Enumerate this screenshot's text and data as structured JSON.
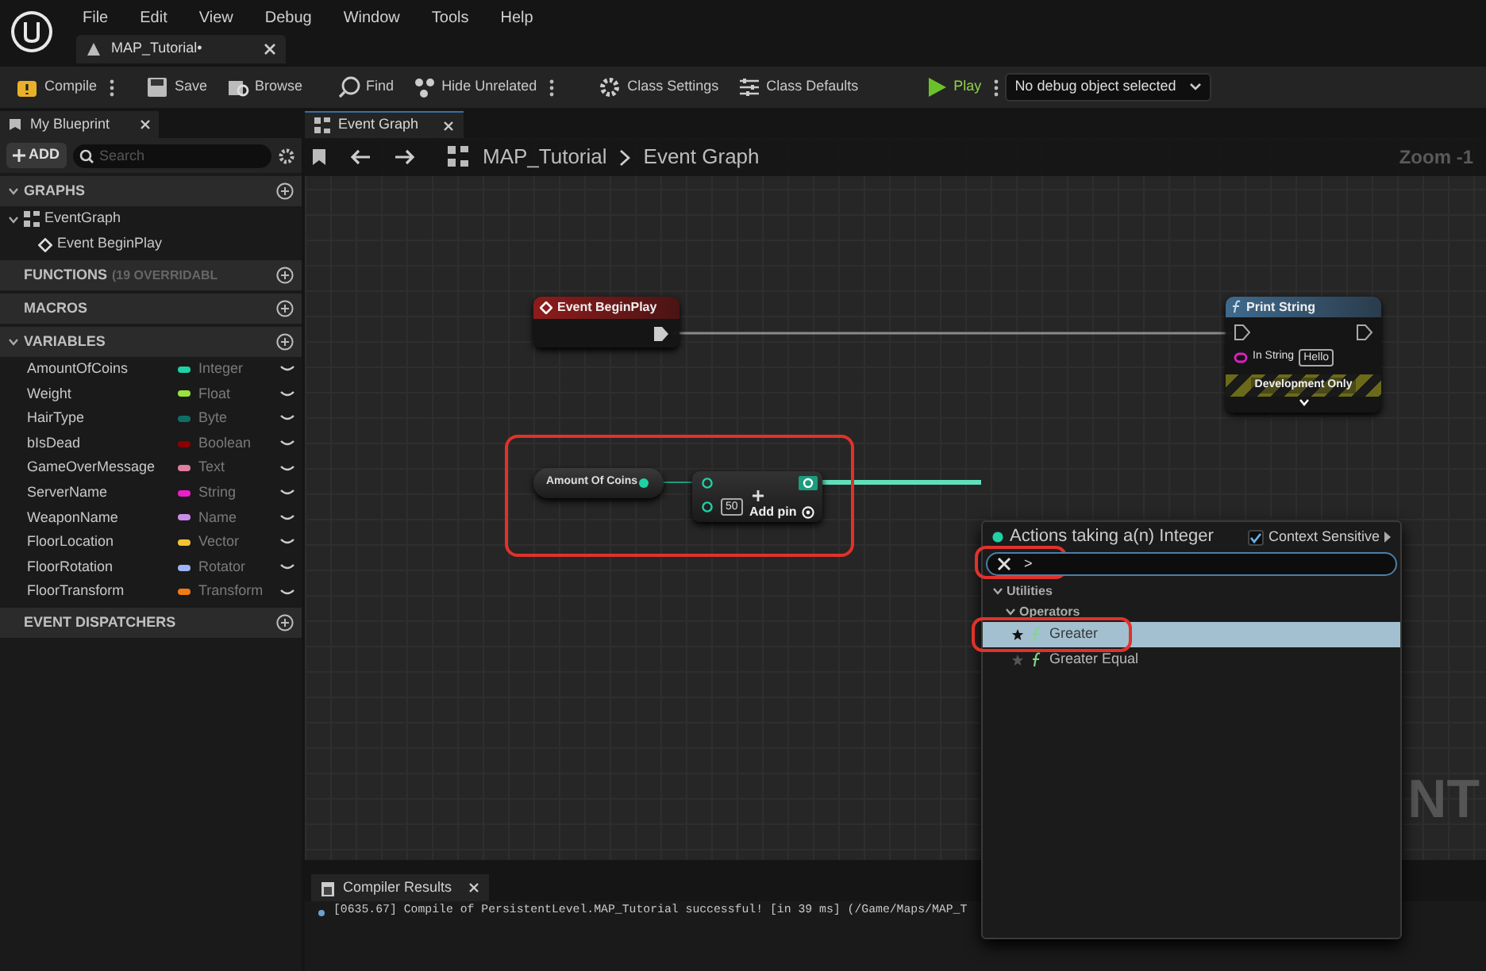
{
  "menu": [
    "File",
    "Edit",
    "View",
    "Debug",
    "Window",
    "Tools",
    "Help"
  ],
  "document_tab": {
    "label": "MAP_Tutorial•"
  },
  "toolbar": [
    {
      "kind": "compile",
      "label": "Compile",
      "more": true
    },
    {
      "kind": "save",
      "label": "Save",
      "more": false
    },
    {
      "kind": "browse",
      "label": "Browse",
      "more": false
    },
    {
      "kind": "find",
      "label": "Find",
      "more": false
    },
    {
      "kind": "hide",
      "label": "Hide Unrelated",
      "more": true
    },
    {
      "kind": "settings",
      "label": "Class Settings",
      "more": false
    },
    {
      "kind": "defaults",
      "label": "Class Defaults",
      "more": false
    },
    {
      "kind": "play",
      "label": "Play",
      "more": true
    },
    {
      "kind": "dropdown",
      "label": "No debug object selected"
    }
  ],
  "my_blueprint": {
    "tab": "My Blueprint",
    "add": "ADD",
    "search_placeholder": "Search",
    "sections": [
      {
        "title": "GRAPHS",
        "expanded": true,
        "children": [
          {
            "label": "EventGraph",
            "expanded": true,
            "children": [
              {
                "label": "Event BeginPlay"
              }
            ]
          }
        ]
      },
      {
        "title": "FUNCTIONS",
        "note": "(19 OVERRIDABL",
        "expanded": false
      },
      {
        "title": "MACROS",
        "expanded": false
      },
      {
        "title": "VARIABLES",
        "expanded": true,
        "variables": [
          {
            "name": "AmountOfCoins",
            "type": "Integer",
            "color": "#1fd1a5"
          },
          {
            "name": "Weight",
            "type": "Float",
            "color": "#9ae03f"
          },
          {
            "name": "HairType",
            "type": "Byte",
            "color": "#0f6e63"
          },
          {
            "name": "bIsDead",
            "type": "Boolean",
            "color": "#8a0000"
          },
          {
            "name": "GameOverMessage",
            "type": "Text",
            "color": "#e07fa0"
          },
          {
            "name": "ServerName",
            "type": "String",
            "color": "#ec1ec7"
          },
          {
            "name": "WeaponName",
            "type": "Name",
            "color": "#c98ee6"
          },
          {
            "name": "FloorLocation",
            "type": "Vector",
            "color": "#f3c332"
          },
          {
            "name": "FloorRotation",
            "type": "Rotator",
            "color": "#9fb3f5"
          },
          {
            "name": "FloorTransform",
            "type": "Transform",
            "color": "#f07a14"
          }
        ]
      },
      {
        "title": "EVENT DISPATCHERS",
        "expanded": false
      }
    ]
  },
  "graph_tab": {
    "label": "Event Graph"
  },
  "breadcrumb": [
    "MAP_Tutorial",
    "Event Graph"
  ],
  "zoom_label": "Zoom -1",
  "watermark": "NT",
  "nodes": [
    {
      "kind": "event",
      "title": "Event BeginPlay"
    },
    {
      "kind": "function",
      "title": "Print String",
      "pin_label": "In String",
      "pin_value": "Hello",
      "footer": "Development Only"
    },
    {
      "kind": "variable",
      "title": "Amount Of Coins"
    },
    {
      "kind": "add",
      "value": "50",
      "add_pin": "Add pin",
      "highlighted": true
    }
  ],
  "action_menu": {
    "title": "Actions taking a(n) Integer",
    "context_sensitive": {
      "label": "Context Sensitive",
      "checked": true
    },
    "search": {
      "value": ">",
      "highlighted": true
    },
    "categories": [
      {
        "label": "Utilities",
        "expanded": true,
        "children": [
          {
            "label": "Operators",
            "expanded": true,
            "children": [
              {
                "label": "Greater",
                "selected": true,
                "favorite": true,
                "highlighted": true
              },
              {
                "label": "Greater Equal",
                "selected": false,
                "favorite": false,
                "highlighted": false
              }
            ]
          }
        ]
      }
    ]
  },
  "compiler_results": {
    "tab": "Compiler Results",
    "messages": [
      "[0635.67] Compile of PersistentLevel.MAP_Tutorial successful! [in 39 ms] (/Game/Maps/MAP_T"
    ]
  }
}
